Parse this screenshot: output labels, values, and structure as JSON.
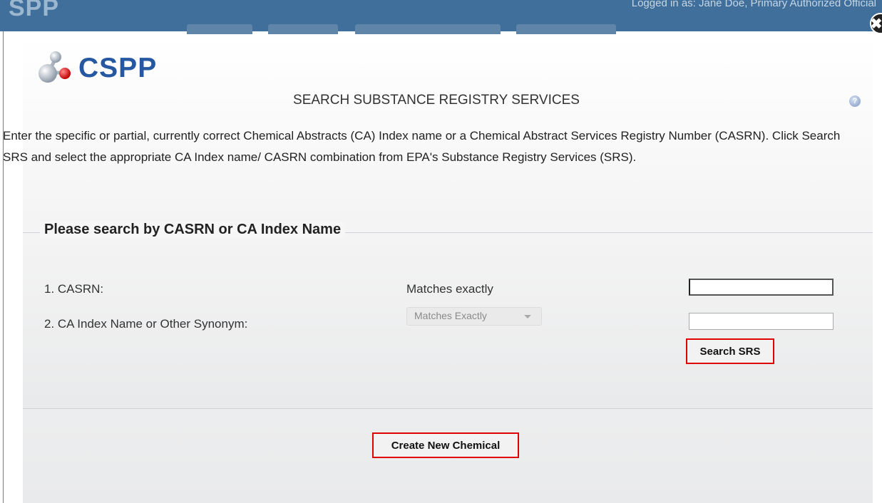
{
  "background": {
    "logo_text": "SPP",
    "logged_in_text": "Logged in as: Jane Doe, Primary Authorized Official"
  },
  "modal": {
    "close_symbol": "✖",
    "logo_text": "CSPP",
    "title": "SEARCH SUBSTANCE REGISTRY SERVICES",
    "help_symbol": "?",
    "instructions": "Enter the specific or partial, currently correct Chemical Abstracts (CA) Index name or a Chemical Abstract Services Registry Number (CASRN). Click Search SRS and select the appropriate CA Index name/ CASRN combination from EPA's Substance Registry Services (SRS).",
    "search_panel": {
      "legend": "Please search by CASRN or CA Index Name",
      "rows": [
        {
          "label": "1. CASRN:",
          "match_text": "Matches exactly",
          "value": ""
        },
        {
          "label": "2. CA Index Name or Other Synonym:",
          "match_select_value": "Matches Exactly",
          "value": ""
        }
      ],
      "search_button": "Search SRS"
    },
    "create_button": "Create New Chemical"
  },
  "colors": {
    "accent": "#2558a0",
    "highlight": "#e00000"
  }
}
